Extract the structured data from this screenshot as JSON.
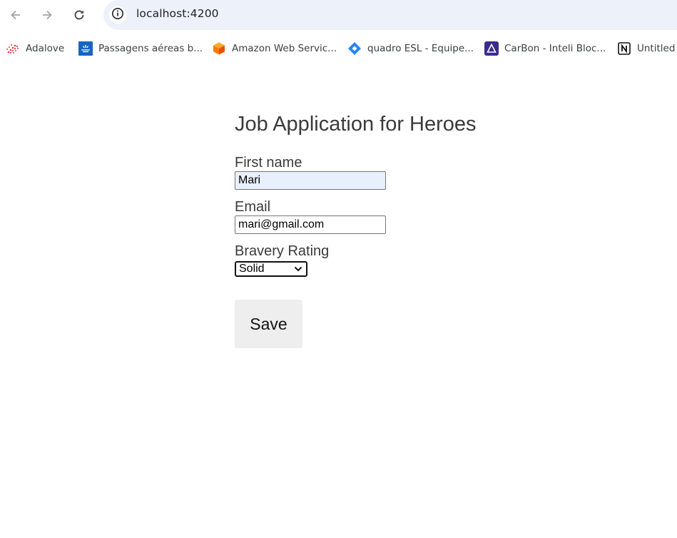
{
  "browser": {
    "url": "localhost:4200",
    "bookmarks": [
      {
        "label": "Adalove",
        "icon": "adalove-icon"
      },
      {
        "label": "Passagens aéreas b...",
        "icon": "airline-icon"
      },
      {
        "label": "Amazon Web Servic...",
        "icon": "aws-cube-icon"
      },
      {
        "label": "quadro ESL - Equipe...",
        "icon": "jira-icon"
      },
      {
        "label": "CarBon - Inteli Bloc...",
        "icon": "carbon-triangle-icon"
      },
      {
        "label": "Untitled",
        "icon": "notion-icon"
      }
    ]
  },
  "form": {
    "title": "Job Application for Heroes",
    "first_name_label": "First name",
    "first_name_value": "Mari",
    "email_label": "Email",
    "email_value": "mari@gmail.com",
    "bravery_label": "Bravery Rating",
    "bravery_value": "Solid",
    "save_label": "Save"
  },
  "colors": {
    "omnibox_bg": "#edf2fa",
    "autofill_bg": "#e8f0fe",
    "button_bg": "#eeeeee",
    "text": "#3a3a3a"
  }
}
